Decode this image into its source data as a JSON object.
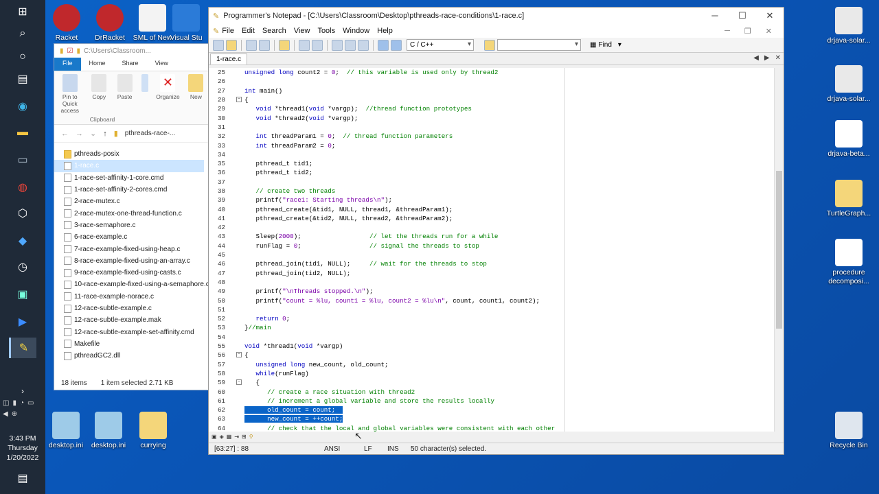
{
  "taskbar": {
    "time": "3:43 PM",
    "day": "Thursday",
    "date": "1/20/2022"
  },
  "desktop_icons_left": [
    {
      "label": "Racket"
    },
    {
      "label": "DrRacket"
    },
    {
      "label": "SML of New"
    },
    {
      "label": "Visual Stu"
    }
  ],
  "desktop_icons_right": [
    {
      "label": "drjava-solar..."
    },
    {
      "label": "drjava-solar..."
    },
    {
      "label": "drjava-beta..."
    },
    {
      "label": "TurtleGraph..."
    },
    {
      "label": "procedure decomposi..."
    },
    {
      "label": "Recycle Bin"
    }
  ],
  "desktop_icons_bottom": [
    {
      "label": "desktop.ini"
    },
    {
      "label": "desktop.ini"
    },
    {
      "label": "currying"
    }
  ],
  "explorer": {
    "path_title": "C:\\Users\\Classroom...",
    "tabs": [
      "File",
      "Home",
      "Share",
      "View"
    ],
    "ribbon": {
      "pin": "Pin to Quick access",
      "copy": "Copy",
      "paste": "Paste",
      "organize": "Organize",
      "new": "New",
      "group": "Clipboard"
    },
    "breadcrumb": "pthreads-race-...",
    "files": [
      "pthreads-posix",
      "1-race.c",
      "1-race-set-affinity-1-core.cmd",
      "1-race-set-affinity-2-cores.cmd",
      "2-race-mutex.c",
      "2-race-mutex-one-thread-function.c",
      "3-race-semaphore.c",
      "6-race-example.c",
      "7-race-example-fixed-using-heap.c",
      "8-race-example-fixed-using-an-array.c",
      "9-race-example-fixed-using-casts.c",
      "10-race-example-fixed-using-a-semaphore.c",
      "11-race-example-norace.c",
      "12-race-subtle-example.c",
      "12-race-subtle-example.mak",
      "12-race-subtle-example-set-affinity.cmd",
      "Makefile",
      "pthreadGC2.dll"
    ],
    "status_count": "18 items",
    "status_selected": "1 item selected  2.71 KB"
  },
  "notepad": {
    "title": "Programmer's Notepad - [C:\\Users\\Classroom\\Desktop\\pthreads-race-conditions\\1-race.c]",
    "menu": [
      "File",
      "Edit",
      "Search",
      "View",
      "Tools",
      "Window",
      "Help"
    ],
    "language": "C / C++",
    "find_label": "Find",
    "tab": "1-race.c",
    "status": {
      "position": "[63:27] : 88",
      "encoding": "ANSI",
      "line_ending": "LF",
      "mode": "INS",
      "selection": "50 character(s) selected."
    }
  }
}
